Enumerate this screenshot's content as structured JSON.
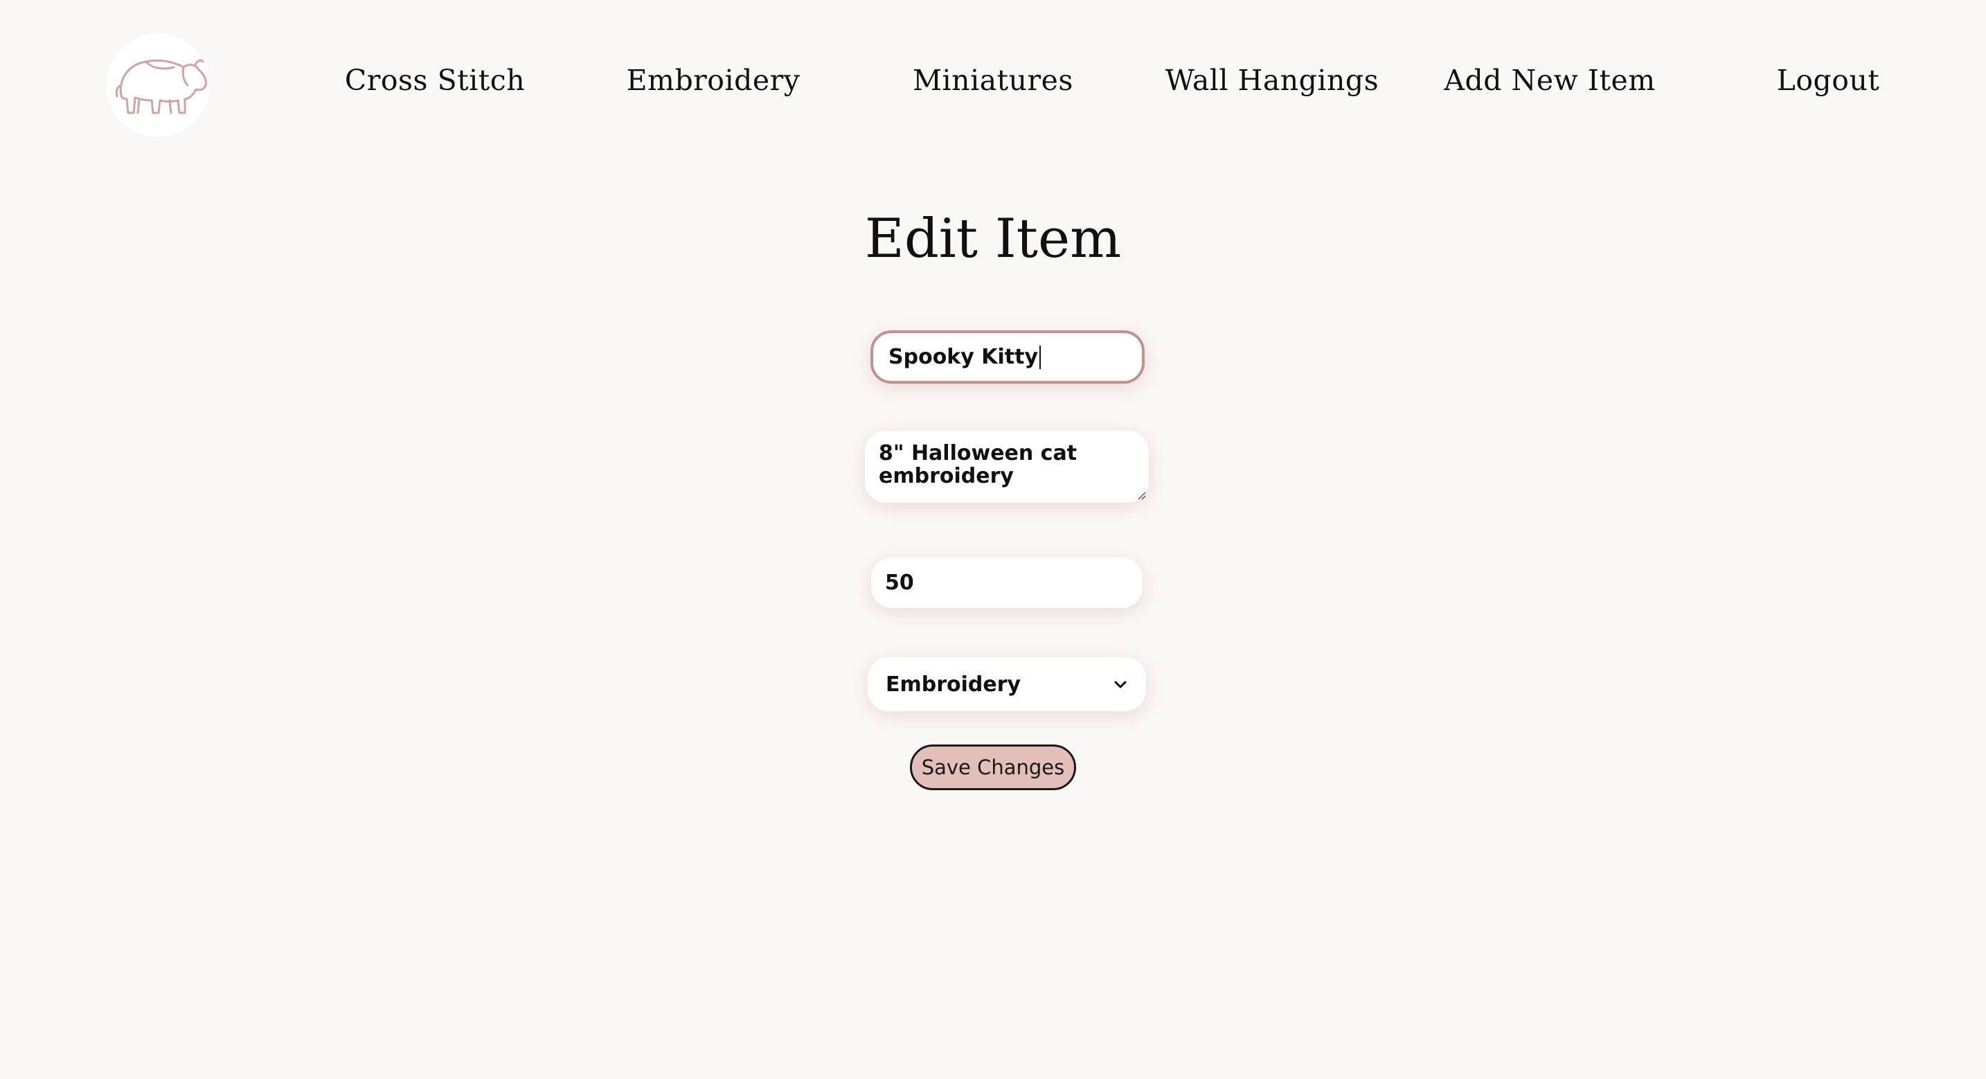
{
  "nav": {
    "logo_icon": "bison-logo-icon",
    "links": [
      {
        "label": "Cross Stitch"
      },
      {
        "label": "Embroidery"
      },
      {
        "label": "Miniatures"
      },
      {
        "label": "Wall Hangings"
      },
      {
        "label": "Add New Item"
      },
      {
        "label": "Logout"
      }
    ]
  },
  "page": {
    "title": "Edit Item"
  },
  "form": {
    "name_value": "Spooky Kitty",
    "description_value": "8\" Halloween cat embroidery",
    "price_value": "50",
    "category_selected": "Embroidery",
    "save_label": "Save Changes"
  },
  "colors": {
    "background": "#faf8f6",
    "accent": "#c2928c",
    "button_fill": "#e2bfb8",
    "logo_stroke": "#d3a39d"
  }
}
